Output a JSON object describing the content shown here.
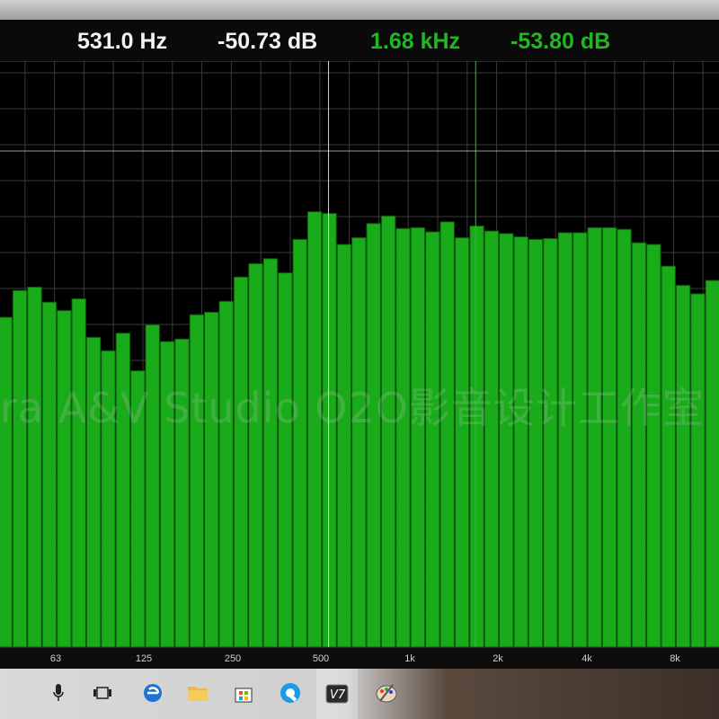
{
  "readout": {
    "cursor1_freq": "531.0 Hz",
    "cursor1_level": "-50.73 dB",
    "cursor2_freq": "1.68 kHz",
    "cursor2_level": "-53.80 dB"
  },
  "colors": {
    "bar": "#1aab1a",
    "bar_edge": "#0b5d0b",
    "grid": "#3a3a3a",
    "cursor_white": "#d8d8d8",
    "cursor_green": "#2fbf2f"
  },
  "watermark": "ra A&V Studio O2O影音设计工作室",
  "chart_data": {
    "type": "bar",
    "x_scale": "log frequency",
    "tick_labels": [
      "63",
      "125",
      "250",
      "500",
      "1k",
      "2k",
      "4k",
      "8k"
    ],
    "cursors": [
      {
        "freq_hz": 531.0,
        "level_db": -50.73
      },
      {
        "freq_hz": 1680,
        "level_db": -53.8
      }
    ],
    "values_db": [
      -70.6,
      -67.4,
      -67.0,
      -68.8,
      -69.8,
      -68.4,
      -73.0,
      -74.6,
      -72.5,
      -77.0,
      -71.5,
      -73.5,
      -73.2,
      -70.3,
      -70.0,
      -68.7,
      -65.8,
      -64.2,
      -63.6,
      -65.3,
      -61.3,
      -58.0,
      -58.2,
      -61.9,
      -61.1,
      -59.4,
      -58.5,
      -60.0,
      -59.9,
      -60.4,
      -59.2,
      -61.1,
      -59.7,
      -60.3,
      -60.6,
      -61.0,
      -61.3,
      -61.2,
      -60.5,
      -60.5,
      -59.9,
      -59.9,
      -60.1,
      -61.7,
      -61.9,
      -64.5,
      -66.8,
      -67.8,
      -66.2
    ],
    "ylim_db": [
      -110,
      -40
    ]
  },
  "taskbar": {
    "icons": [
      "microphone-icon",
      "task-view-icon",
      "edge-icon",
      "file-explorer-icon",
      "store-icon",
      "app-q-icon",
      "v7-icon",
      "paint-icon"
    ]
  }
}
